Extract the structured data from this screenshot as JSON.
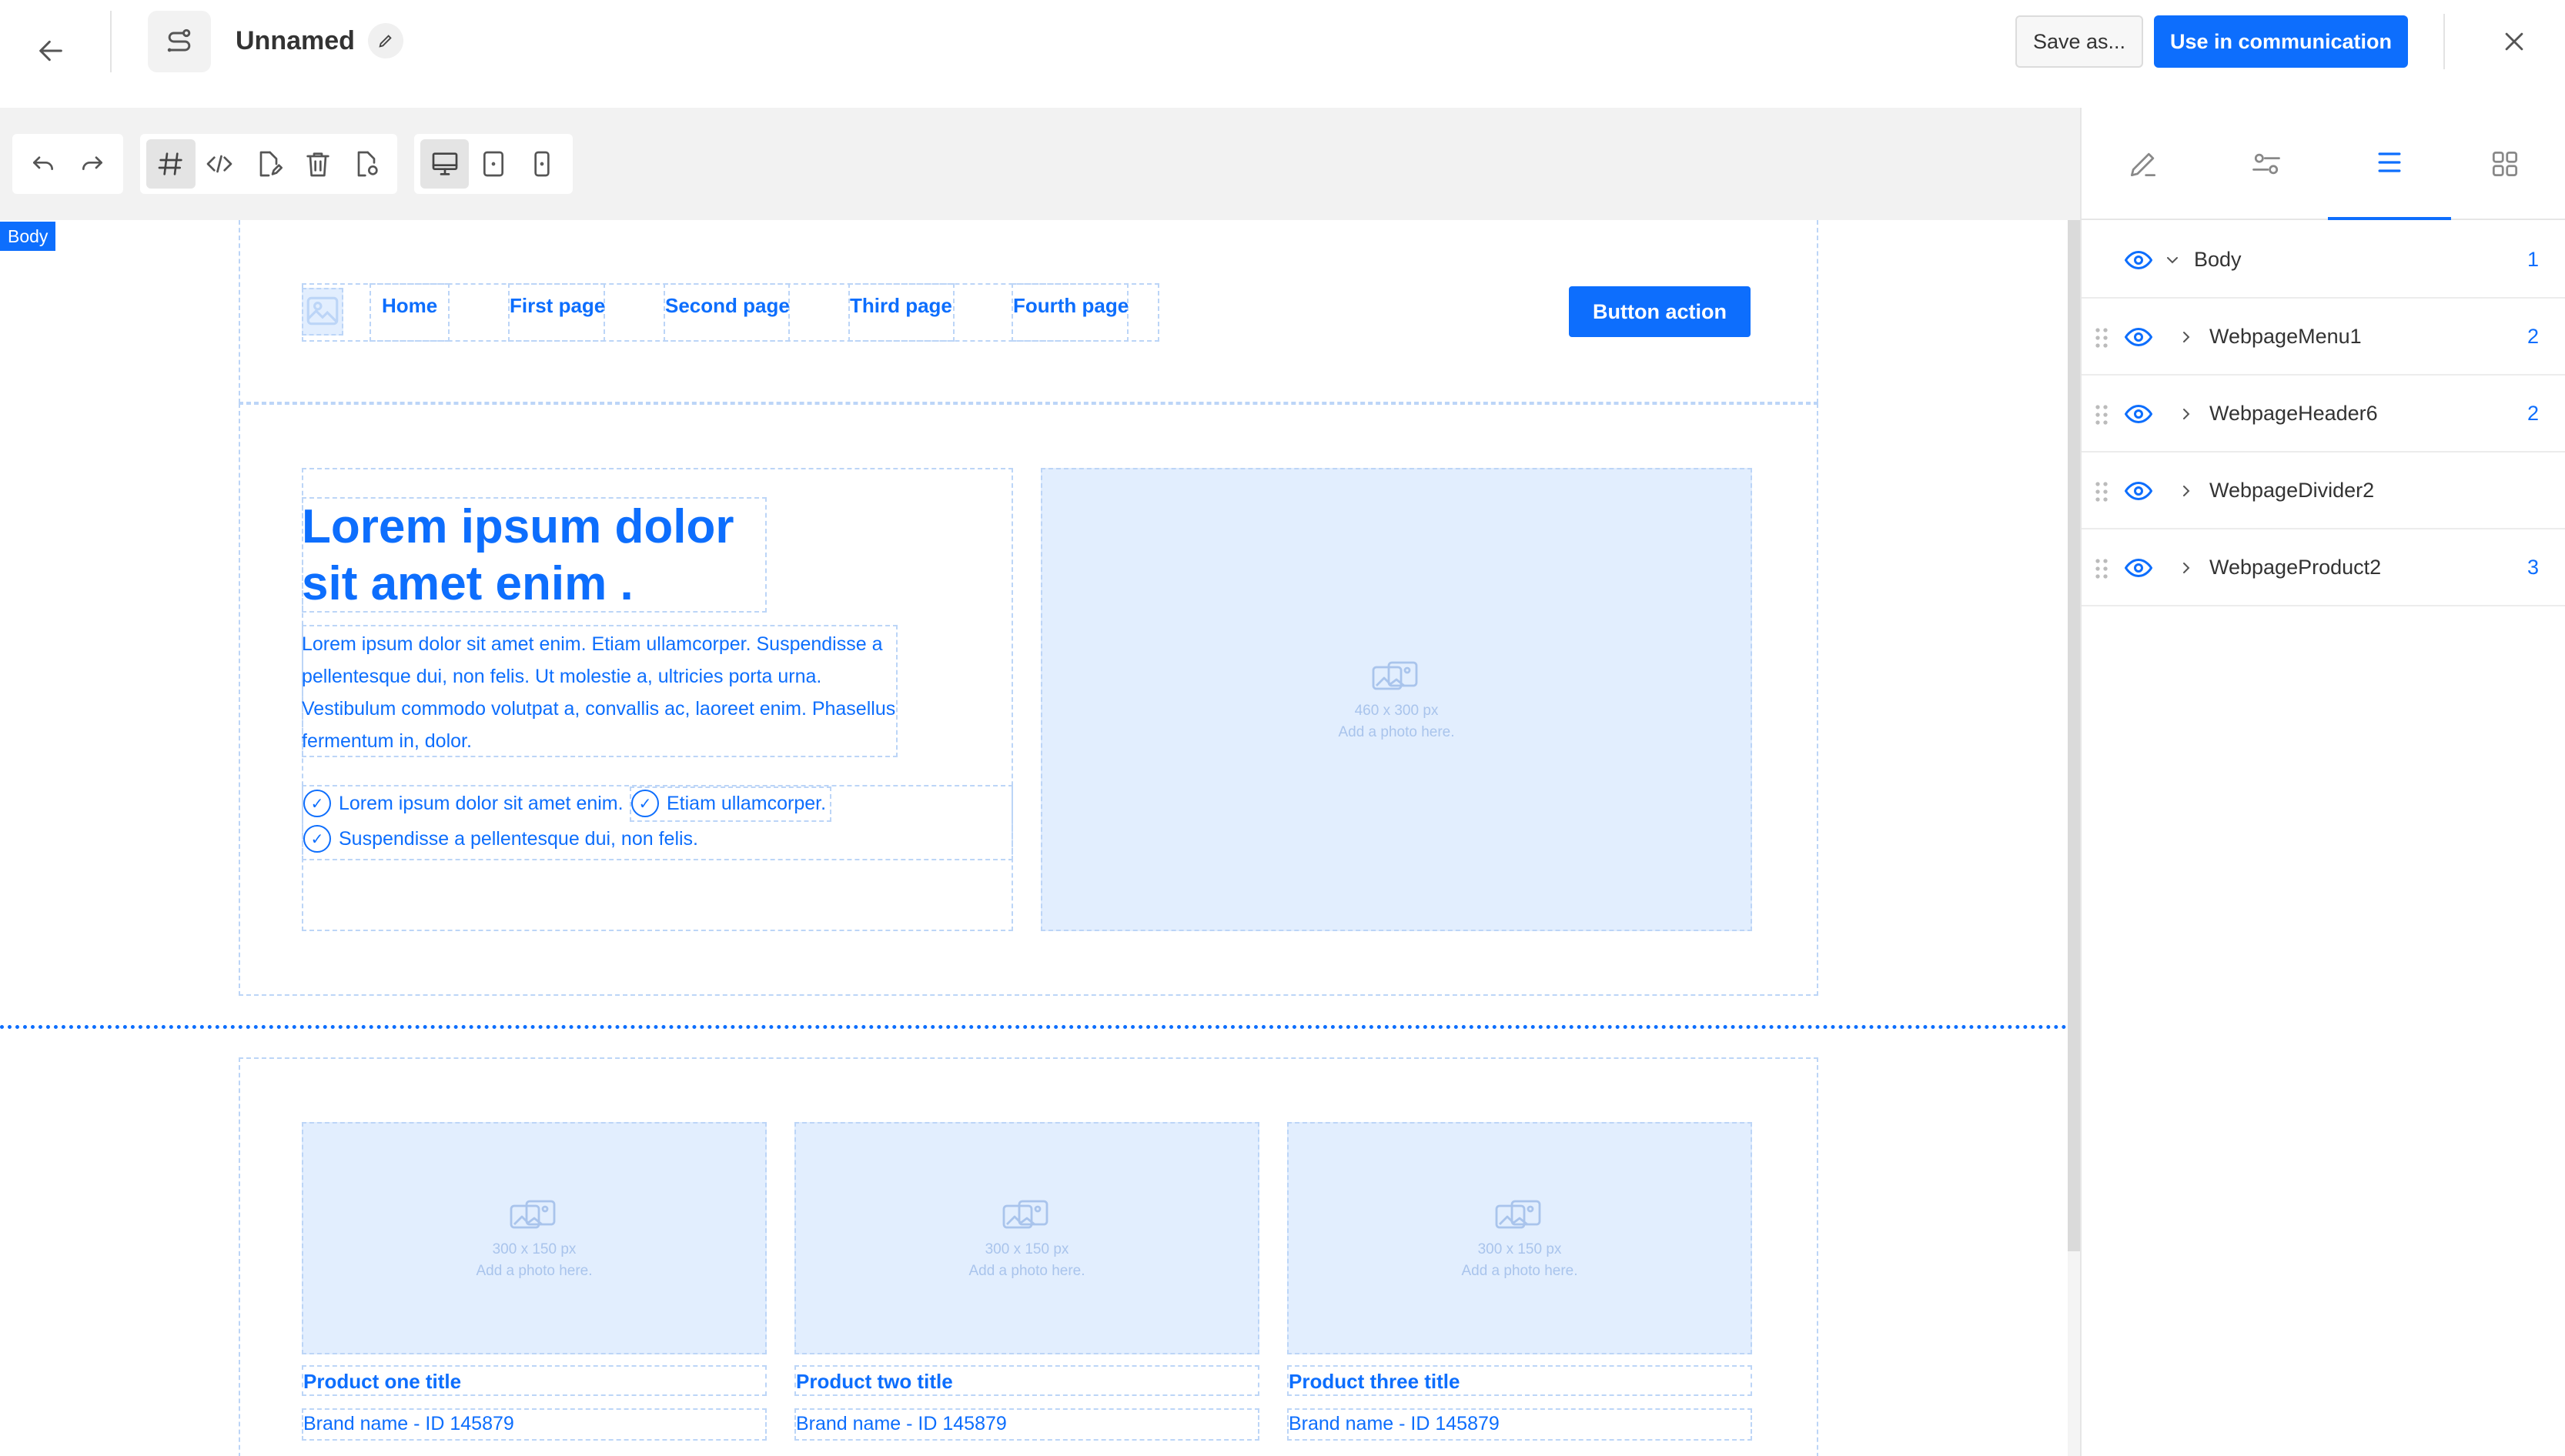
{
  "header": {
    "title": "Unnamed",
    "save_label": "Save as...",
    "use_label": "Use in communication"
  },
  "canvas": {
    "body_tag": "Body",
    "menu": {
      "links": [
        "Home",
        "First page",
        "Second page",
        "Third page",
        "Fourth page"
      ],
      "button_label": "Button action"
    },
    "hero": {
      "title": "Lorem ipsum dolor sit amet enim .",
      "text": "Lorem ipsum dolor sit amet enim. Etiam ullamcorper. Suspendisse a pellentesque dui, non felis. Ut molestie a, ultricies porta urna. Vestibulum commodo volutpat a, convallis ac, laoreet enim. Phasellus fermentum in, dolor.",
      "checks": [
        "Lorem ipsum dolor sit amet enim.",
        "Etiam ullamcorper.",
        "Suspendisse a pellentesque dui, non felis."
      ],
      "image_size": "460 x 300 px",
      "image_hint": "Add a photo here."
    },
    "products": [
      {
        "title": "Product one title",
        "brand": "Brand name - ID 145879",
        "image_size": "300 x 150 px",
        "image_hint": "Add a photo here."
      },
      {
        "title": "Product two title",
        "brand": "Brand name - ID 145879",
        "image_size": "300 x 150 px",
        "image_hint": "Add a photo here."
      },
      {
        "title": "Product three title",
        "brand": "Brand name - ID 145879",
        "image_size": "300 x 150 px",
        "image_hint": "Add a photo here."
      }
    ]
  },
  "layers_panel": {
    "active_tab": "layers",
    "tabs": [
      "edit-icon",
      "settings-icon",
      "layers-icon",
      "blocks-icon"
    ],
    "items": [
      {
        "name": "Body",
        "count": "1"
      },
      {
        "name": "WebpageMenu1",
        "count": "2"
      },
      {
        "name": "WebpageHeader6",
        "count": "2"
      },
      {
        "name": "WebpageDivider2",
        "count": ""
      },
      {
        "name": "WebpageProduct2",
        "count": "3"
      }
    ]
  },
  "colors": {
    "accent": "#0d6efd",
    "placeholder_bg": "#e2eefe",
    "outline": "#bcd5f7"
  }
}
